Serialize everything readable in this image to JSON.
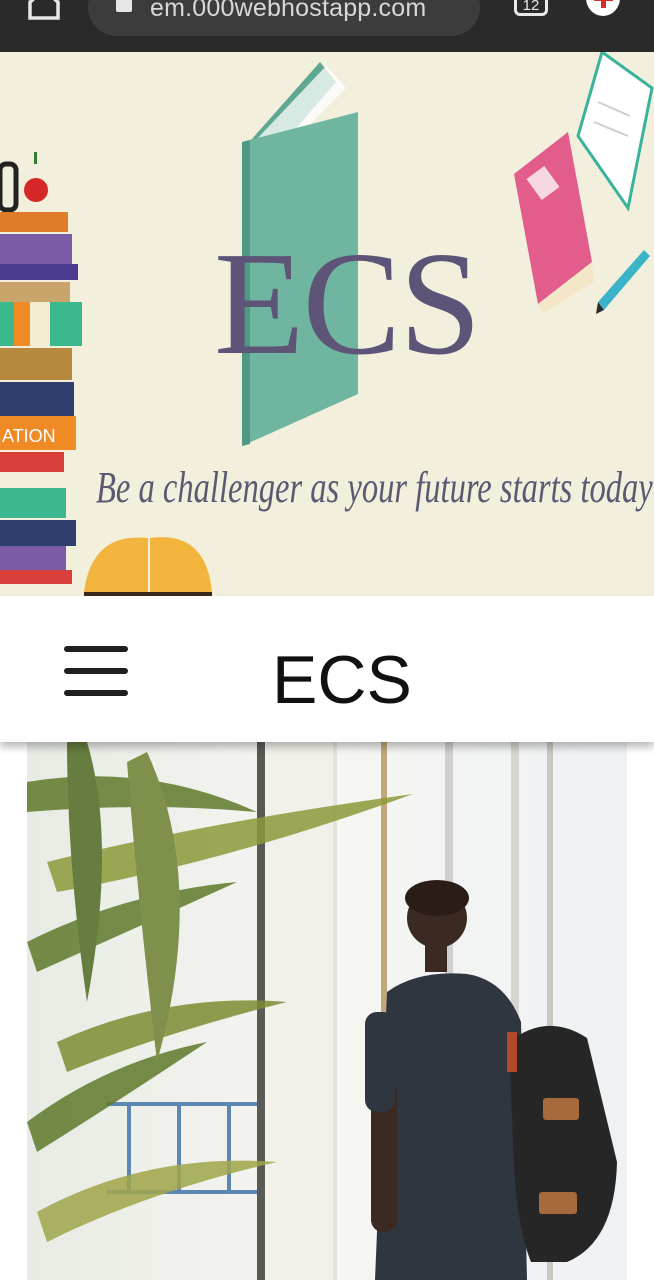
{
  "browser": {
    "url": "em.000webhostapp.com",
    "tab_count": "12"
  },
  "banner": {
    "title": "ECS",
    "tagline": "Be a challenger as your future starts today",
    "book_label": "ATION"
  },
  "header": {
    "site_title": "ECS"
  },
  "colors": {
    "chrome": "#2a2a2a",
    "banner_bg": "#f2f0dd",
    "banner_title": "#5e5478",
    "teal_book": "#6fb59f",
    "pink_book": "#e35d8c"
  },
  "icons": {
    "home": "home-icon",
    "lock": "lock-icon",
    "tabs": "tabs-icon",
    "menu": "hamburger-icon"
  }
}
